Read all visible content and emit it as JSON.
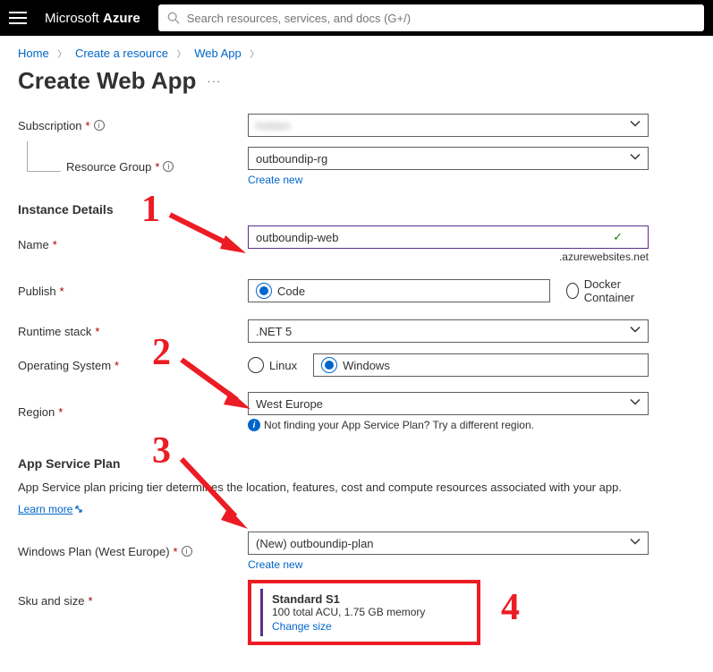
{
  "header": {
    "brand_prefix": "Microsoft ",
    "brand_suffix": "Azure",
    "search_placeholder": "Search resources, services, and docs (G+/)"
  },
  "breadcrumbs": {
    "home": "Home",
    "create_resource": "Create a resource",
    "web_app": "Web App"
  },
  "title": "Create Web App",
  "labels": {
    "subscription": "Subscription",
    "resource_group": "Resource Group",
    "instance_details": "Instance Details",
    "name": "Name",
    "publish": "Publish",
    "runtime_stack": "Runtime stack",
    "os": "Operating System",
    "region": "Region",
    "app_service_plan": "App Service Plan",
    "windows_plan": "Windows Plan (West Europe)",
    "sku": "Sku and size"
  },
  "values": {
    "subscription": "hidden",
    "resource_group": "outboundip-rg",
    "name": "outboundip-web",
    "name_suffix": ".azurewebsites.net",
    "runtime_stack": ".NET 5",
    "region": "West Europe",
    "windows_plan": "(New) outboundip-plan"
  },
  "links": {
    "create_new": "Create new",
    "learn_more": "Learn more",
    "change_size": "Change size"
  },
  "radios": {
    "code": "Code",
    "docker": "Docker Container",
    "linux": "Linux",
    "windows": "Windows"
  },
  "hints": {
    "region": "Not finding your App Service Plan? Try a different region.",
    "asp_desc": "App Service plan pricing tier determines the location, features, cost and compute resources associated with your app."
  },
  "sku": {
    "title": "Standard S1",
    "detail": "100 total ACU, 1.75 GB memory"
  },
  "annotations": {
    "n1": "1",
    "n2": "2",
    "n3": "3",
    "n4": "4"
  }
}
